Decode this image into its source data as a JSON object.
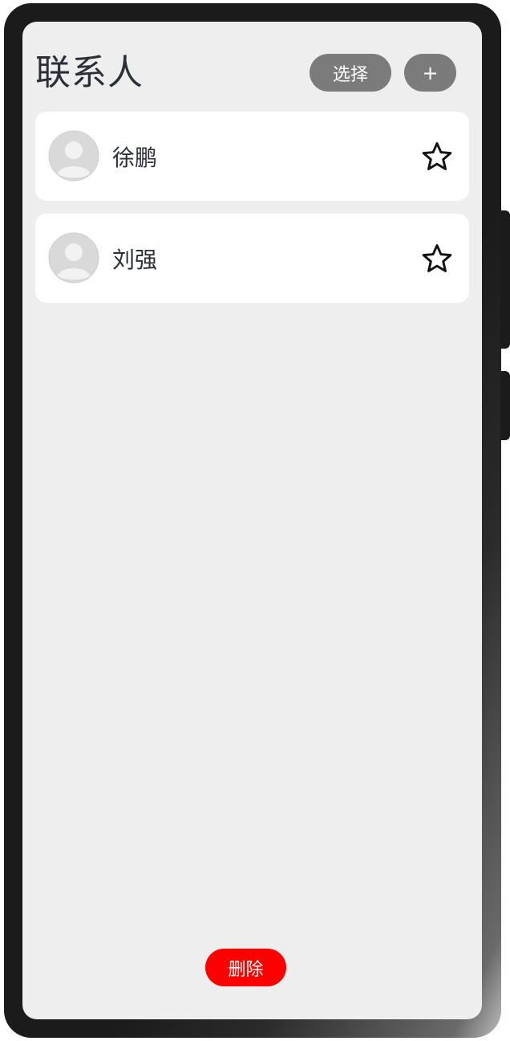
{
  "header": {
    "title": "联系人",
    "select_label": "选择",
    "add_label": "+"
  },
  "contacts": [
    {
      "name": "徐鹏",
      "favorite_icon": "star-outline-icon",
      "avatar_icon": "person-avatar-icon"
    },
    {
      "name": "刘强",
      "favorite_icon": "star-outline-icon",
      "avatar_icon": "person-avatar-icon"
    }
  ],
  "footer": {
    "delete_label": "删除"
  },
  "colors": {
    "screen_bg": "#eeeeee",
    "pill_bg": "#7b7b7b",
    "delete_bg": "#ff0000",
    "text": "#2a2f38",
    "avatar": "#d9d9d9"
  }
}
